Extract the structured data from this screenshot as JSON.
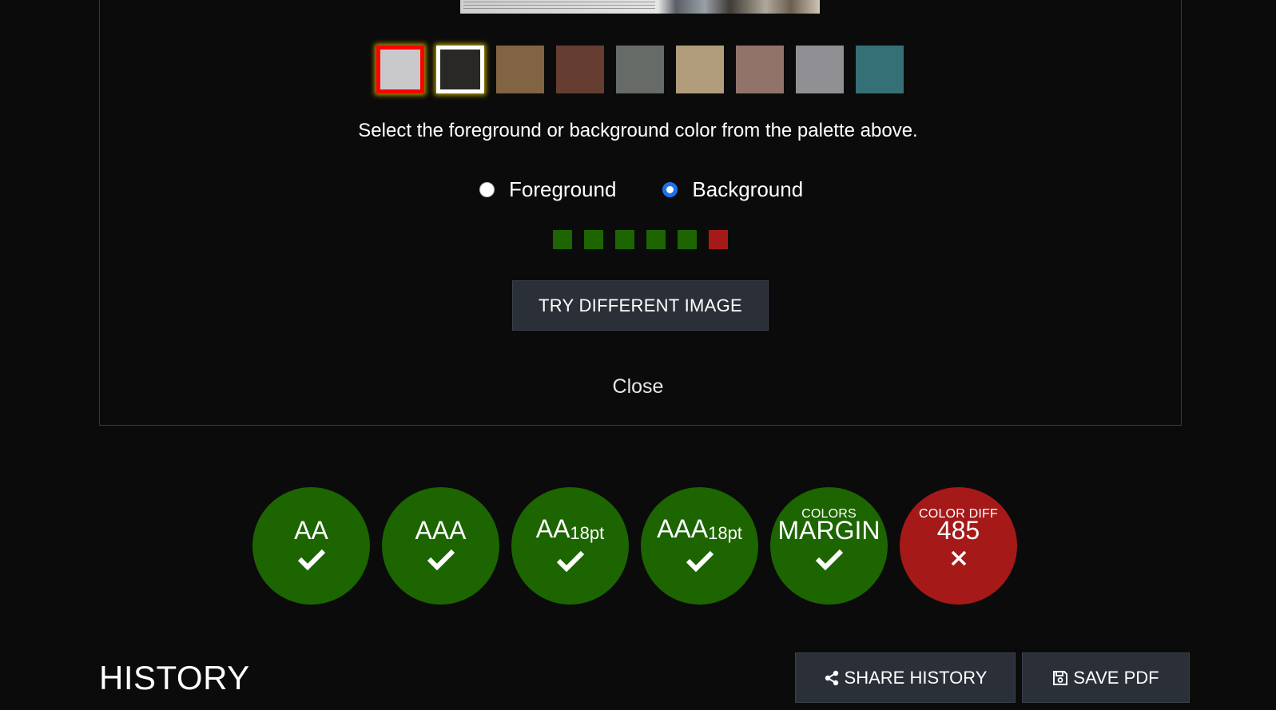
{
  "palette": [
    {
      "color": "#c9c9cc",
      "state": "foreground"
    },
    {
      "color": "#2a2826",
      "state": "background"
    },
    {
      "color": "#806444",
      "state": ""
    },
    {
      "color": "#653e31",
      "state": ""
    },
    {
      "color": "#666b67",
      "state": ""
    },
    {
      "color": "#b19c7b",
      "state": ""
    },
    {
      "color": "#92736a",
      "state": ""
    },
    {
      "color": "#8f8f94",
      "state": ""
    },
    {
      "color": "#357076",
      "state": ""
    }
  ],
  "instruction": "Select the foreground or background color from the palette above.",
  "radio": {
    "foreground_label": "Foreground",
    "background_label": "Background",
    "selected": "background"
  },
  "indicator_dots": [
    "#1c6500",
    "#1c6500",
    "#1c6500",
    "#1c6500",
    "#1c6500",
    "#a51919"
  ],
  "try_button_label": "TRY DIFFERENT IMAGE",
  "close_label": "Close",
  "results": [
    {
      "label": "AA",
      "suffix": "",
      "top_label": "",
      "pass": true
    },
    {
      "label": "AAA",
      "suffix": "",
      "top_label": "",
      "pass": true
    },
    {
      "label": "AA",
      "suffix": "18pt",
      "top_label": "",
      "pass": true
    },
    {
      "label": "AAA",
      "suffix": "18pt",
      "top_label": "",
      "pass": true
    },
    {
      "label": "MARGIN",
      "suffix": "",
      "top_label": "COLORS",
      "pass": true
    },
    {
      "label": "485",
      "suffix": "",
      "top_label": "COLOR DIFF",
      "pass": false
    }
  ],
  "colors": {
    "pass": "#1c6500",
    "fail": "#a51919"
  },
  "history": {
    "title": "HISTORY",
    "share_label": "SHARE HISTORY",
    "save_label": "SAVE PDF"
  }
}
